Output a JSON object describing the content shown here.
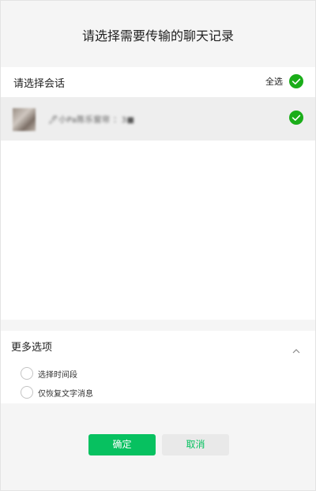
{
  "dialog": {
    "title": "请选择需要传输的聊天记录"
  },
  "conversation_panel": {
    "label": "请选择会话",
    "select_all_label": "全选",
    "select_all_checked": true,
    "items": [
      {
        "name": "🖊小Pa陈乐窗帘 ：3■",
        "checked": true
      }
    ]
  },
  "more_options": {
    "title": "更多选项",
    "expanded": true,
    "items": [
      {
        "label": "选择时间段",
        "checked": false
      },
      {
        "label": "仅恢复文字消息",
        "checked": false
      }
    ]
  },
  "actions": {
    "confirm_label": "确定",
    "cancel_label": "取消"
  },
  "colors": {
    "accent_green": "#07c160",
    "check_green": "#1aad19",
    "background": "#f5f5f5"
  }
}
